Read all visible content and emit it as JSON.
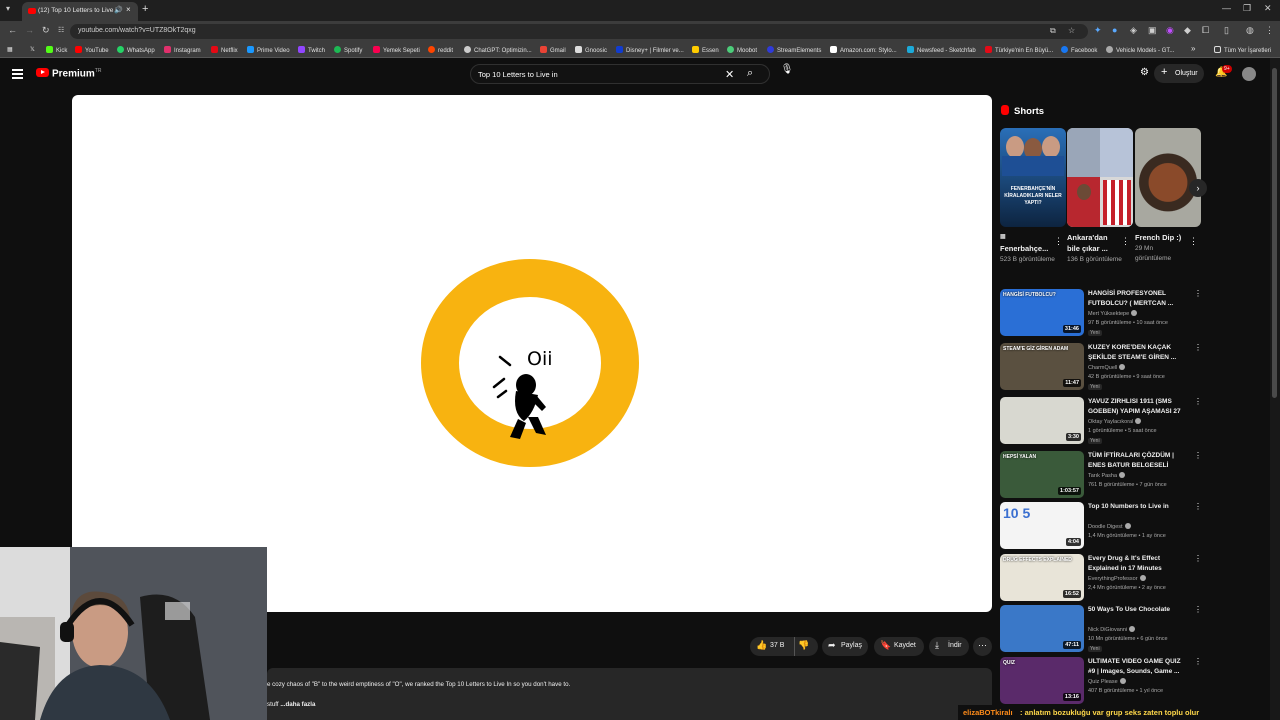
{
  "browser": {
    "tab_title": "(12) Top 10 Letters to Live i",
    "url": "youtube.com/watch?v=UTZ8OkT2qxg",
    "bookmarks": [
      "Kick",
      "YouTube",
      "WhatsApp",
      "Instagram",
      "Netflix",
      "Prime Video",
      "Twitch",
      "Spotify",
      "Yemek Sepeti",
      "reddit",
      "ChatGPT: Optimizin...",
      "Gmail",
      "Gnoosic",
      "Disney+ | Filmler ve...",
      "Essen",
      "Moobot",
      "StreamElements",
      "Amazon.com: Stylo...",
      "Newsfeed - Sketchfab",
      "Türkiye'nin En Büyü...",
      "Facebook",
      "Vehicle Models - GT..."
    ],
    "bookmarks_overflow": "»",
    "all_bookmarks": "Tüm Yer İşaretleri"
  },
  "header": {
    "logo_text": "Premium",
    "logo_sup": "TR",
    "search_value": "Top 10 Letters to Live in",
    "create_label": "Oluştur",
    "notifications_badge": "9+"
  },
  "video": {
    "drawing_text": "Oii"
  },
  "actions": {
    "likes": "37 B",
    "share": "Paylaş",
    "save": "Kaydet",
    "download": "İndir"
  },
  "description": {
    "text": "e cozy chaos of \"B\" to the weird emptiness of \"O\", we ranked the Top 10 Letters to Live In so you don't have to.",
    "more_prefix": "stuff",
    "more_label": "...daha fazla"
  },
  "chat": {
    "user": "elizaBOTkiralı",
    "message": ": anlatım bozukluğu var grup seks zaten toplu olur"
  },
  "shorts": {
    "title": "Shorts",
    "items": [
      {
        "title": "Fenerbahçe...",
        "views": "523 B görüntüleme",
        "thumb_text": "FENERBAHÇE'NİN KİRALADIKLARI NELER YAPTI?"
      },
      {
        "title": "Ankara'dan bile çıkar ...",
        "views": "136 B görüntüleme"
      },
      {
        "title": "French Dip :)",
        "views": "29 Mn görüntüleme"
      }
    ]
  },
  "recommendations": [
    {
      "title": "HANGİSİ PROFESYONEL FUTBOLCU? ( MERTCAN ...",
      "channel": "Mert Yüksektepe",
      "meta": "97 B görüntüleme • 10 saat önce",
      "badge": "Yeni",
      "duration": "31:46",
      "thumb_text": "HANGİSİ FUTBOLCU?",
      "color": "#2a6fd6"
    },
    {
      "title": "KUZEY KORE'DEN KAÇAK ŞEKİLDE STEAM'E GİREN ...",
      "channel": "CharmQuell",
      "meta": "42 B görüntüleme • 9 saat önce",
      "badge": "Yeni",
      "duration": "11:47",
      "thumb_text": "STEAM'E GİZ GİREN ADAM",
      "color": "#5a5040"
    },
    {
      "title": "YAVUZ ZIRHLISI 1911 (SMS GOEBEN) YAPIM AŞAMASI 27",
      "channel": "Oktay Yaylacıkoral",
      "meta": "1 görüntüleme • 5 saat önce",
      "badge": "Yeni",
      "duration": "3:30",
      "thumb_text": "",
      "color": "#d8d8d0"
    },
    {
      "title": "TÜM İFTİRALARI ÇÖZDÜM | ENES BATUR BELGESELİ",
      "channel": "Tarık Pasha",
      "meta": "761 B görüntüleme • 7 gün önce",
      "badge": "",
      "duration": "1:03:57",
      "thumb_text": "HEPSİ YALAN",
      "color": "#3a5a3a"
    },
    {
      "title": "Top 10 Numbers to Live in",
      "channel": "Doodle Digest",
      "meta": "1,4 Mn görüntüleme • 1 ay önce",
      "badge": "",
      "duration": "4:04",
      "thumb_text": "10 5",
      "color": "#f4f4f4"
    },
    {
      "title": "Every Drug & It's Effect Explained in 17 Minutes",
      "channel": "EverythingProfessor",
      "meta": "2,4 Mn görüntüleme • 2 ay önce",
      "badge": "",
      "duration": "16:52",
      "thumb_text": "DRUG EFFECTS EXPLAINED",
      "color": "#e8e4d8"
    },
    {
      "title": "50 Ways To Use Chocolate",
      "channel": "Nick DiGiovanni",
      "meta": "10 Mn görüntüleme • 6 gün önce",
      "badge": "Yeni",
      "duration": "47:11",
      "thumb_text": "",
      "color": "#3a78c8"
    },
    {
      "title": "ULTIMATE VIDEO GAME QUIZ #9 | Images, Sounds, Game ...",
      "channel": "Quiz Please",
      "meta": "407 B görüntüleme • 1 yıl önce",
      "badge": "",
      "duration": "13:16",
      "thumb_text": "QUIZ",
      "color": "#5a2a6a"
    }
  ],
  "colors": {
    "accent_red": "#ff0000",
    "ring_yellow": "#f8b310",
    "chat_user": "#ff8c1a",
    "chat_text": "#ffd84a"
  }
}
